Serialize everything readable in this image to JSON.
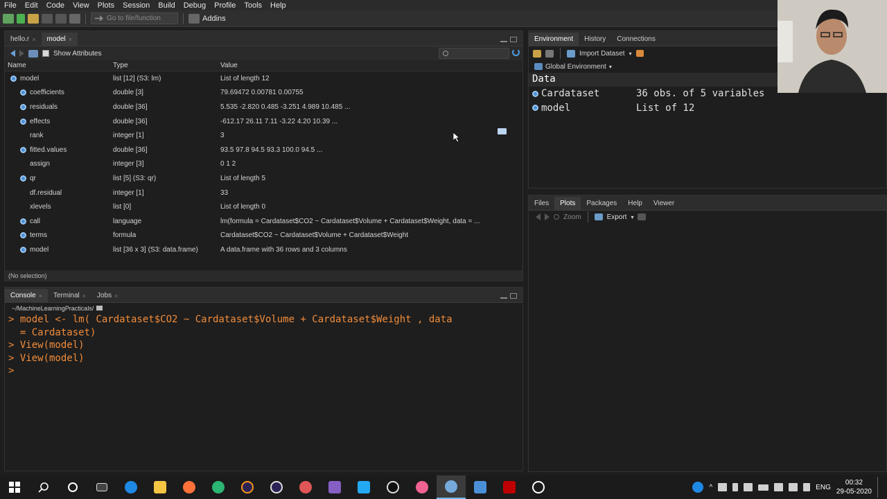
{
  "menu": [
    "File",
    "Edit",
    "Code",
    "View",
    "Plots",
    "Session",
    "Build",
    "Debug",
    "Profile",
    "Tools",
    "Help"
  ],
  "toolbar": {
    "goto_placeholder": "Go to file/function",
    "addins_label": "Addins"
  },
  "source": {
    "tabs": [
      {
        "label": "hello.r",
        "active": false
      },
      {
        "label": "model",
        "active": true
      }
    ],
    "show_attributes_label": "Show Attributes",
    "columns": [
      "Name",
      "Type",
      "Value"
    ],
    "rows": [
      {
        "name": "model",
        "type": "list [12] (S3: lm)",
        "value": "List of length 12",
        "bullet": true,
        "indent": 0
      },
      {
        "name": "coefficients",
        "type": "double [3]",
        "value": "79.69472 0.00781 0.00755",
        "bullet": true,
        "indent": 1
      },
      {
        "name": "residuals",
        "type": "double [36]",
        "value": "5.535 -2.820 0.485 -3.251 4.989 10.485 ...",
        "bullet": true,
        "indent": 1
      },
      {
        "name": "effects",
        "type": "double [36]",
        "value": "-612.17 26.11 7.11 -3.22 4.20 10.39 ...",
        "bullet": true,
        "indent": 1
      },
      {
        "name": "rank",
        "type": "integer [1]",
        "value": "3",
        "bullet": false,
        "indent": 1
      },
      {
        "name": "fitted.values",
        "type": "double [36]",
        "value": "93.5 97.8 94.5 93.3 100.0 94.5 ...",
        "bullet": true,
        "indent": 1
      },
      {
        "name": "assign",
        "type": "integer [3]",
        "value": "0 1 2",
        "bullet": false,
        "indent": 1
      },
      {
        "name": "qr",
        "type": "list [5] (S3: qr)",
        "value": "List of length 5",
        "bullet": true,
        "indent": 1
      },
      {
        "name": "df.residual",
        "type": "integer [1]",
        "value": "33",
        "bullet": false,
        "indent": 1
      },
      {
        "name": "xlevels",
        "type": "list [0]",
        "value": "List of length 0",
        "bullet": false,
        "indent": 1
      },
      {
        "name": "call",
        "type": "language",
        "value": "lm(formula = Cardataset$CO2 ~ Cardataset$Volume + Cardataset$Weight, data = ...",
        "bullet": true,
        "indent": 1
      },
      {
        "name": "terms",
        "type": "formula",
        "value": "Cardataset$CO2 ~ Cardataset$Volume + Cardataset$Weight",
        "bullet": true,
        "indent": 1
      },
      {
        "name": "model",
        "type": "list [36 x 3] (S3: data.frame)",
        "value": "A data.frame with 36 rows and 3 columns",
        "bullet": true,
        "indent": 1
      }
    ],
    "status": "(No selection)"
  },
  "console": {
    "tabs": [
      {
        "label": "Console",
        "active": true
      },
      {
        "label": "Terminal",
        "active": false
      },
      {
        "label": "Jobs",
        "active": false
      }
    ],
    "path": "~/MachineLearningPracticals/",
    "lines": [
      "> model <- lm( Cardataset$CO2 ~ Cardataset$Volume + Cardataset$Weight , data",
      "  = Cardataset)",
      "> View(model)",
      "> View(model)",
      "> "
    ]
  },
  "environment": {
    "tabs": [
      {
        "label": "Environment",
        "active": true
      },
      {
        "label": "History",
        "active": false
      },
      {
        "label": "Connections",
        "active": false
      }
    ],
    "import_label": "Import Dataset",
    "scope_label": "Global Environment",
    "section": "Data",
    "rows": [
      {
        "name": "Cardataset",
        "value": "36 obs. of 5 variables"
      },
      {
        "name": "model",
        "value": "List of 12"
      }
    ]
  },
  "files": {
    "tabs": [
      {
        "label": "Files",
        "active": false
      },
      {
        "label": "Plots",
        "active": true
      },
      {
        "label": "Packages",
        "active": false
      },
      {
        "label": "Help",
        "active": false
      },
      {
        "label": "Viewer",
        "active": false
      }
    ],
    "zoom_label": "Zoom",
    "export_label": "Export"
  },
  "taskbar": {
    "lang": "ENG",
    "time": "00:32",
    "date": "29-05-2020"
  },
  "colors": {
    "accent": "#4a8ed4",
    "console_text": "#f28c3a",
    "background": "#1e1e1e"
  }
}
